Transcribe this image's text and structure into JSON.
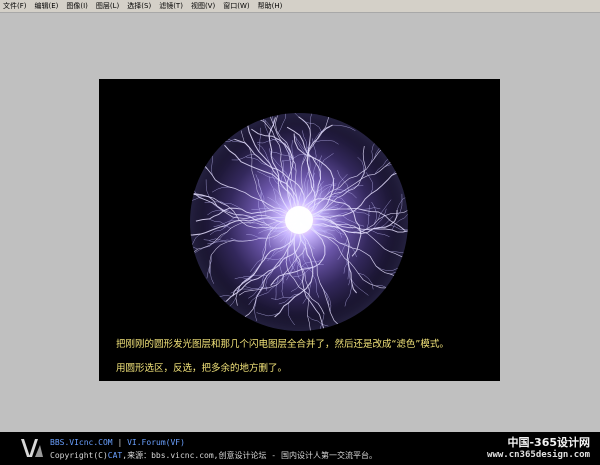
{
  "menu": {
    "items": [
      {
        "label": "文件(F)"
      },
      {
        "label": "编辑(E)"
      },
      {
        "label": "图像(I)"
      },
      {
        "label": "图层(L)"
      },
      {
        "label": "选择(S)"
      },
      {
        "label": "滤镜(T)"
      },
      {
        "label": "视图(V)"
      },
      {
        "label": "窗口(W)"
      },
      {
        "label": "帮助(H)"
      }
    ]
  },
  "canvas": {
    "caption_1": "把刚刚的圆形发光图层和那几个闪电图层全合并了，然后还是改成“滤色”模式。",
    "caption_2": "用圆形选区，反选，把多余的地方删了。"
  },
  "footer": {
    "site": "BBS.VIcnc.COM",
    "separator": "|",
    "forum": "VI.Forum(VF)",
    "copyright_prefix": "Copyright(C)",
    "copyright_author": "CAT",
    "source_text": ",来源：bbs.vicnc.com,创意设计论坛 - 国内设计人第一交流平台。",
    "watermark": "中国-365设计网",
    "watermark_url": "www.cn365design.com"
  },
  "colors": {
    "background": "#c0c0c0",
    "canvas": "#000000",
    "caption": "#f3e47a",
    "footer_bg": "#000000",
    "footer_accent": "#6aa0ff"
  }
}
